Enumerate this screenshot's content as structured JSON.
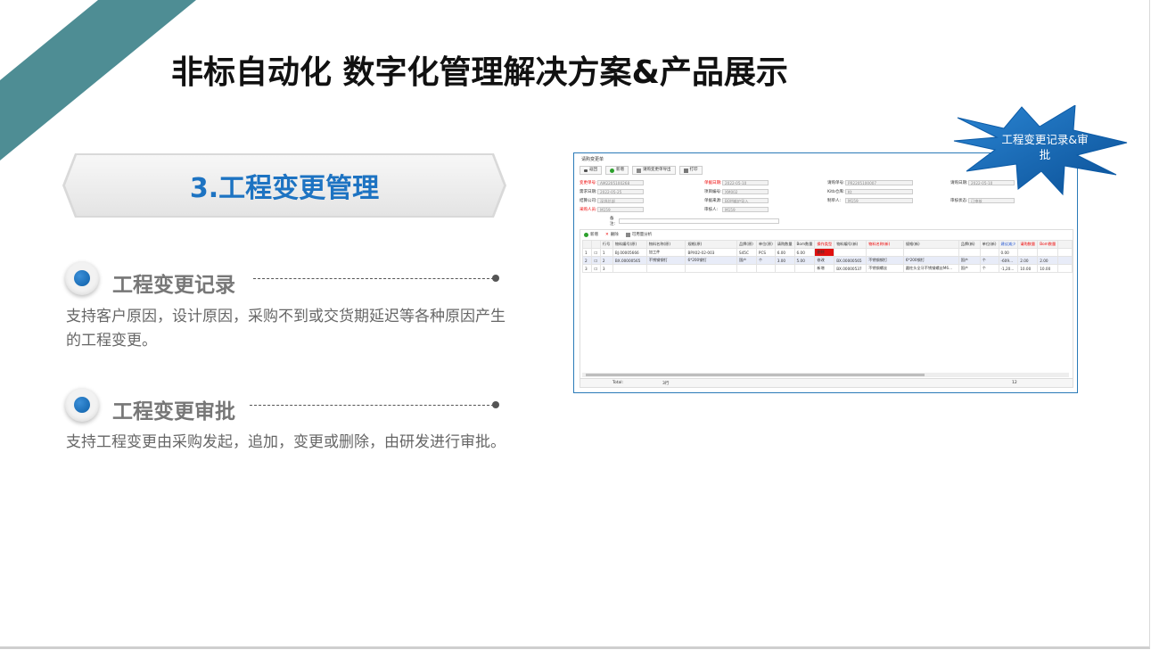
{
  "slide": {
    "title": "非标自动化 数字化管理解决方案&产品展示",
    "section_title": "3.工程变更管理",
    "items": [
      {
        "title": "工程变更记录",
        "desc": "支持客户原因，设计原因，采购不到或交货期延迟等各种原因产生的工程变更。"
      },
      {
        "title": "工程变更审批",
        "desc": "支持工程变更由采购发起，追加，变更或删除，由研发进行审批。"
      }
    ],
    "callout": "工程变更记录&审批",
    "colors": {
      "accent_stripe": "#4e8d94",
      "title_blue": "#1d73c2",
      "callout_blue": "#1b72c6"
    }
  },
  "screenshot": {
    "window_title": "请购变更单",
    "toolbar": [
      {
        "label": "返回",
        "icon": "back-icon"
      },
      {
        "label": "新增",
        "icon": "plus-icon"
      },
      {
        "label": "请购变更单导出",
        "icon": "export-icon"
      },
      {
        "label": "打印",
        "icon": "print-icon"
      }
    ],
    "form": {
      "change_no_label": "变更单号:",
      "change_no": "AM2205100268",
      "change_date_label": "单据日期:",
      "change_date": "2022-05-10",
      "req_no_label": "请购单号:",
      "req_no": "PR2205100007",
      "req_date_label": "请购日期:",
      "req_date": "2022-05-10",
      "need_date_label": "需求日期:",
      "need_date": "2022-05-25",
      "project_no_label": "项目编号:",
      "project_no": "XM002",
      "warehouse_label": "Kitb仓库:",
      "warehouse": "Kt",
      "company_label": "结算公司:",
      "company": "深圳总部",
      "source_label": "单据来源:",
      "source": "BOM维护导入",
      "maker_label": "制单人:",
      "maker": "M159",
      "audit_status_label": "审核状态:",
      "audit_status": "已审核",
      "buyer_label": "采购人员:",
      "buyer": "M159",
      "auditor_label": "审核人:",
      "auditor": "M159",
      "remark_label": "备注:"
    },
    "grid_tools": [
      "新增",
      "删除",
      "可用量分析"
    ],
    "columns": [
      {
        "t": "",
        "c": ""
      },
      {
        "t": "",
        "c": ""
      },
      {
        "t": "行号",
        "c": ""
      },
      {
        "t": "物料编号(原)",
        "c": ""
      },
      {
        "t": "物料名称(原)",
        "c": ""
      },
      {
        "t": "规格(原)",
        "c": ""
      },
      {
        "t": "品牌(原)",
        "c": ""
      },
      {
        "t": "单位(原)",
        "c": ""
      },
      {
        "t": "请购数量",
        "c": ""
      },
      {
        "t": "Bom数量",
        "c": ""
      },
      {
        "t": "操作类型",
        "c": "red"
      },
      {
        "t": "物料编号(新)",
        "c": ""
      },
      {
        "t": "物料名称(新)",
        "c": "red"
      },
      {
        "t": "规格(新)",
        "c": ""
      },
      {
        "t": "品牌(新)",
        "c": ""
      },
      {
        "t": "单位(新)",
        "c": ""
      },
      {
        "t": "建议减少",
        "c": "blue"
      },
      {
        "t": "请购数量",
        "c": "red"
      },
      {
        "t": "Bom数量",
        "c": "red"
      },
      {
        "t": "",
        "c": ""
      }
    ],
    "rows": [
      [
        "1",
        "",
        "1",
        "BJ.00005666",
        "加工件",
        "BPX02-02-003",
        "S45C",
        "PCS",
        "6.00",
        "6.00",
        "删除",
        "",
        "",
        "",
        "",
        "",
        "0.00",
        "",
        "",
        ""
      ],
      [
        "2",
        "",
        "2",
        "BX.00000565",
        "不锈钢钢钉",
        "6*200钢钉",
        "国产",
        "个",
        "3.00",
        "5.00",
        "修改",
        "BX.00000565",
        "不锈钢钢钉",
        "6*200钢钉",
        "国产",
        "个",
        "-609...",
        "2.00",
        "2.00",
        ""
      ],
      [
        "3",
        "",
        "3",
        "",
        "",
        "",
        "",
        "",
        "",
        "",
        "新增",
        "BX.00000537",
        "不锈钢螺丝",
        "圆柱头全牙不锈钢螺丝M6...",
        "国产",
        "个",
        "-1,20...",
        "10.00",
        "10.00",
        ""
      ]
    ],
    "totals": {
      "label": "Total:",
      "rows": "3行",
      "sum": "12"
    }
  }
}
